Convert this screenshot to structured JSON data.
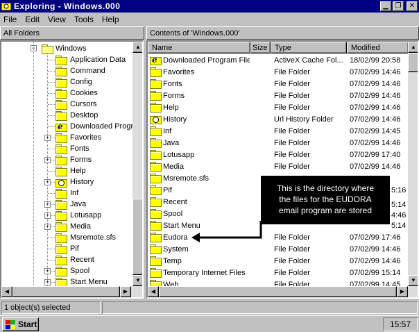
{
  "window": {
    "title": "Exploring - Windows.000"
  },
  "menu": [
    "File",
    "Edit",
    "View",
    "Tools",
    "Help"
  ],
  "left_header": "All Folders",
  "right_header": "Contents of 'Windows.000'",
  "tree": {
    "root": {
      "label": "Windows",
      "icon": "open-folder-icon"
    },
    "items": [
      {
        "label": "Application Data",
        "icon": "folder-icon",
        "expandable": false
      },
      {
        "label": "Command",
        "icon": "folder-icon",
        "expandable": false
      },
      {
        "label": "Config",
        "icon": "folder-icon",
        "expandable": false
      },
      {
        "label": "Cookies",
        "icon": "folder-icon",
        "expandable": false
      },
      {
        "label": "Cursors",
        "icon": "folder-icon",
        "expandable": false
      },
      {
        "label": "Desktop",
        "icon": "folder-icon",
        "expandable": false
      },
      {
        "label": "Downloaded Program Files",
        "icon": "ie-folder-icon",
        "expandable": false
      },
      {
        "label": "Favorites",
        "icon": "folder-icon",
        "expandable": true
      },
      {
        "label": "Fonts",
        "icon": "folder-icon",
        "expandable": false
      },
      {
        "label": "Forms",
        "icon": "folder-icon",
        "expandable": true
      },
      {
        "label": "Help",
        "icon": "folder-icon",
        "expandable": false
      },
      {
        "label": "History",
        "icon": "history-folder-icon",
        "expandable": true
      },
      {
        "label": "Inf",
        "icon": "folder-icon",
        "expandable": false
      },
      {
        "label": "Java",
        "icon": "folder-icon",
        "expandable": true
      },
      {
        "label": "Lotusapp",
        "icon": "folder-icon",
        "expandable": true
      },
      {
        "label": "Media",
        "icon": "folder-icon",
        "expandable": true
      },
      {
        "label": "Msremote.sfs",
        "icon": "folder-icon",
        "expandable": false
      },
      {
        "label": "Pif",
        "icon": "folder-icon",
        "expandable": false
      },
      {
        "label": "Recent",
        "icon": "folder-icon",
        "expandable": false
      },
      {
        "label": "Spool",
        "icon": "folder-icon",
        "expandable": true
      },
      {
        "label": "Start Menu",
        "icon": "folder-icon",
        "expandable": true
      }
    ]
  },
  "columns": [
    "Name",
    "Size",
    "Type",
    "Modified"
  ],
  "files": [
    {
      "name": "Downloaded Program Files",
      "size": "",
      "type": "ActiveX Cache Fol...",
      "modified": "18/02/99 20:58",
      "icon": "ie-folder-icon"
    },
    {
      "name": "Favorites",
      "size": "",
      "type": "File Folder",
      "modified": "07/02/99 14:46",
      "icon": "folder-icon"
    },
    {
      "name": "Fonts",
      "size": "",
      "type": "File Folder",
      "modified": "07/02/99 14:46",
      "icon": "folder-icon"
    },
    {
      "name": "Forms",
      "size": "",
      "type": "File Folder",
      "modified": "07/02/99 14:46",
      "icon": "folder-icon"
    },
    {
      "name": "Help",
      "size": "",
      "type": "File Folder",
      "modified": "07/02/99 14:46",
      "icon": "folder-icon"
    },
    {
      "name": "History",
      "size": "",
      "type": "Url History Folder",
      "modified": "07/02/99 14:46",
      "icon": "history-folder-icon"
    },
    {
      "name": "Inf",
      "size": "",
      "type": "File Folder",
      "modified": "07/02/99 14:45",
      "icon": "folder-icon"
    },
    {
      "name": "Java",
      "size": "",
      "type": "File Folder",
      "modified": "07/02/99 14:46",
      "icon": "folder-icon"
    },
    {
      "name": "Lotusapp",
      "size": "",
      "type": "File Folder",
      "modified": "07/02/99 17:40",
      "icon": "folder-icon"
    },
    {
      "name": "Media",
      "size": "",
      "type": "File Folder",
      "modified": "07/02/99 14:46",
      "icon": "folder-icon"
    },
    {
      "name": "Msremote.sfs",
      "size": "",
      "type": "",
      "modified": "",
      "icon": "folder-icon"
    },
    {
      "name": "Pif",
      "size": "",
      "type": "",
      "modified": "",
      "icon": "folder-icon"
    },
    {
      "name": "Recent",
      "size": "",
      "type": "",
      "modified": "",
      "icon": "folder-icon"
    },
    {
      "name": "Spool",
      "size": "",
      "type": "",
      "modified": "",
      "icon": "folder-icon"
    },
    {
      "name": "Start Menu",
      "size": "",
      "type": "",
      "modified": "",
      "icon": "folder-icon"
    },
    {
      "name": "Eudora",
      "size": "",
      "type": "File Folder",
      "modified": "07/02/99 17:46",
      "icon": "folder-icon"
    },
    {
      "name": "System",
      "size": "",
      "type": "File Folder",
      "modified": "07/02/99 14:46",
      "icon": "folder-icon"
    },
    {
      "name": "Temp",
      "size": "",
      "type": "File Folder",
      "modified": "07/02/99 14:46",
      "icon": "folder-icon"
    },
    {
      "name": "Temporary Internet Files",
      "size": "",
      "type": "File Folder",
      "modified": "07/02/99 15:14",
      "icon": "folder-icon"
    },
    {
      "name": "Web",
      "size": "",
      "type": "File Folder",
      "modified": "07/02/99 14:45",
      "icon": "folder-icon"
    }
  ],
  "hidden_times": [
    "5:16",
    "5:14",
    "4:46",
    "5:14"
  ],
  "callout": {
    "lines": [
      "This is the directory where",
      "the files for the EUDORA",
      "email program are stored"
    ]
  },
  "status": {
    "text": "1 object(s) selected"
  },
  "taskbar": {
    "start_label": "Start",
    "clock": "15:57"
  },
  "colors": {
    "title_bar": "#000080",
    "face": "#c0c0c0",
    "callout_bg": "#000000",
    "folder": "#ffff00"
  }
}
